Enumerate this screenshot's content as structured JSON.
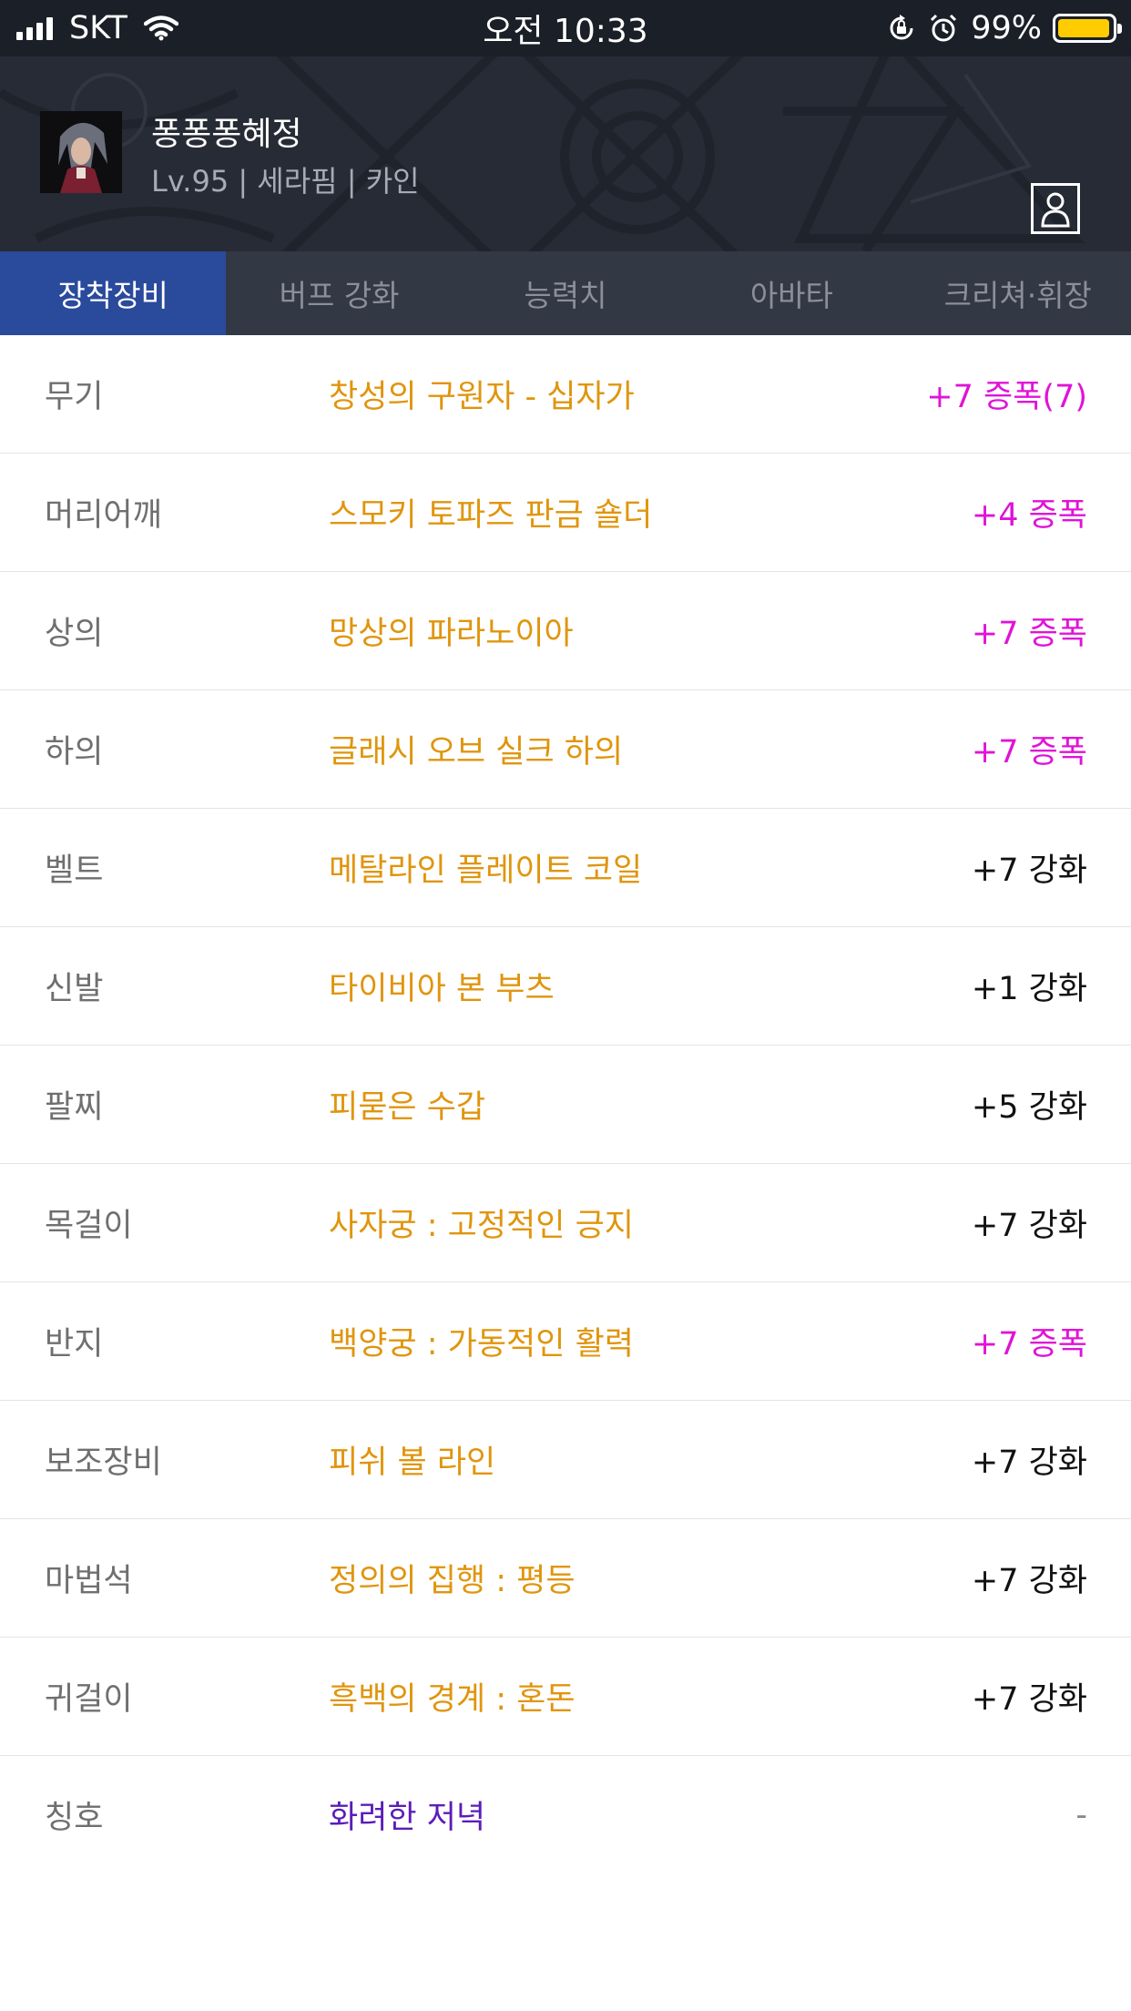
{
  "status_bar": {
    "carrier": "SKT",
    "time": "오전 10:33",
    "battery_percent": "99%",
    "battery_level": 0.99,
    "icons": [
      "signal-icon",
      "wifi-icon",
      "orientation-lock-icon",
      "alarm-icon",
      "battery-icon"
    ]
  },
  "character": {
    "name": "퐁퐁퐁혜정",
    "info": "Lv.95 | 세라핌 | 카인"
  },
  "tabs": [
    {
      "label": "장착장비",
      "active": true
    },
    {
      "label": "버프 강화",
      "active": false
    },
    {
      "label": "능력치",
      "active": false
    },
    {
      "label": "아바타",
      "active": false
    },
    {
      "label": "크리쳐·휘장",
      "active": false
    }
  ],
  "colors": {
    "active_tab": "#2a4a9c",
    "item_name": "#e0950d",
    "title_item": "#5b1db8",
    "amplified": "#e013d8",
    "reinforced": "#111111"
  },
  "equipment": [
    {
      "slot": "무기",
      "item": "창성의 구원자 - 십자가",
      "upgrade": "+7 증폭(7)"
    },
    {
      "slot": "머리어깨",
      "item": "스모키 토파즈 판금 숄더",
      "upgrade": "+4 증폭"
    },
    {
      "slot": "상의",
      "item": "망상의 파라노이아",
      "upgrade": "+7 증폭"
    },
    {
      "slot": "하의",
      "item": "글래시 오브 실크 하의",
      "upgrade": "+7 증폭"
    },
    {
      "slot": "벨트",
      "item": "메탈라인 플레이트 코일",
      "upgrade": "+7 강화"
    },
    {
      "slot": "신발",
      "item": "타이비아 본 부츠",
      "upgrade": "+1 강화"
    },
    {
      "slot": "팔찌",
      "item": "피묻은 수갑",
      "upgrade": "+5 강화"
    },
    {
      "slot": "목걸이",
      "item": "사자궁 : 고정적인 긍지",
      "upgrade": "+7 강화"
    },
    {
      "slot": "반지",
      "item": "백양궁 : 가동적인 활력",
      "upgrade": "+7 증폭"
    },
    {
      "slot": "보조장비",
      "item": "피쉬 볼 라인",
      "upgrade": "+7 강화"
    },
    {
      "slot": "마법석",
      "item": "정의의 집행 : 평등",
      "upgrade": "+7 강화"
    },
    {
      "slot": "귀걸이",
      "item": "흑백의 경계 : 혼돈",
      "upgrade": "+7 강화"
    },
    {
      "slot": "칭호",
      "item": "화려한 저녁",
      "upgrade": "-"
    }
  ]
}
